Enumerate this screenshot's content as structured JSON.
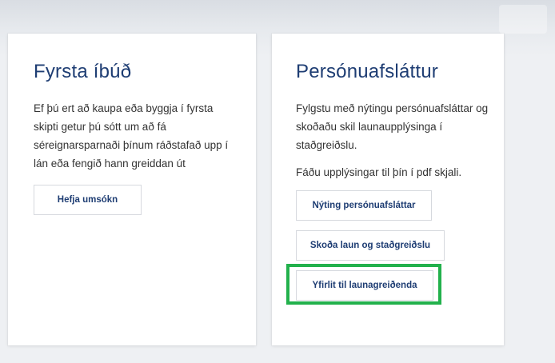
{
  "first_home": {
    "title": "Fyrsta íbúð",
    "description": "Ef þú ert að kaupa eða byggja í fyrsta skipti getur þú sótt um að fá séreignarsparnaði þínum ráðstafað upp í lán eða fengið hann greiddan út",
    "apply_button": "Hefja umsókn"
  },
  "personal_allowance": {
    "title": "Persónuafsláttur",
    "description": "Fylgstu með nýtingu persónuafsláttar og skoðaðu skil launaupplýsinga í staðgreiðslu.",
    "pdf_text": "Fáðu upplýsingar til þín í pdf skjali.",
    "buttons": {
      "usage": "Nýting persónuafsláttar",
      "salary": "Skoða laun og staðgreiðslu",
      "overview": "Yfirlit til launagreiðenda"
    }
  },
  "colors": {
    "title": "#1e3d73",
    "highlight": "#22b14c"
  }
}
